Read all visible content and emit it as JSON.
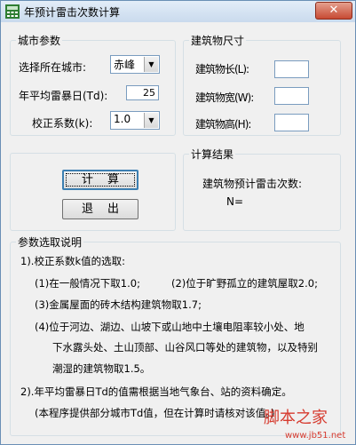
{
  "window": {
    "title": "年预计雷击次数计算",
    "close_glyph": "✕"
  },
  "city_group": {
    "legend": "城市参数",
    "city_label": "选择所在城市:",
    "city_value": "赤峰",
    "td_label": "年平均雷暴日(Td):",
    "td_value": "25",
    "k_label": "校正系数(k):",
    "k_value": "1.0"
  },
  "size_group": {
    "legend": "建筑物尺寸",
    "length_label": "建筑物长(L):",
    "width_label": "建筑物宽(W):",
    "height_label": "建筑物高(H):",
    "length_value": "",
    "width_value": "",
    "height_value": ""
  },
  "buttons": {
    "calc": "计算",
    "exit": "退出"
  },
  "result_group": {
    "legend": "计算结果",
    "heading": "建筑物预计雷击次数:",
    "n_label": "N="
  },
  "notes_group": {
    "legend": "参数选取说明",
    "lines": [
      "1).校正系数k值的选取:",
      "(1)在一般情况下取1.0;",
      "(2)位于旷野孤立的建筑屋取2.0;",
      "(3)金属屋面的砖木结构建筑物取1.7;",
      "(4)位于河边、湖边、山坡下或山地中土壤电阻率较小处、地",
      "下水露头处、土山顶部、山谷风口等处的建筑物，以及特别",
      "潮湿的建筑物取1.5。",
      "2).年平均雷暴日Td的值需根据当地气象台、站的资料确定。",
      "(本程序提供部分城市Td值，但在计算时请核对该值。)"
    ]
  },
  "watermark": {
    "text": "脚本之家",
    "url": "www.jb51.net"
  },
  "colors": {
    "accent": "#3c7fb1",
    "close": "#c74a33",
    "watermark": "#d63b2f"
  }
}
